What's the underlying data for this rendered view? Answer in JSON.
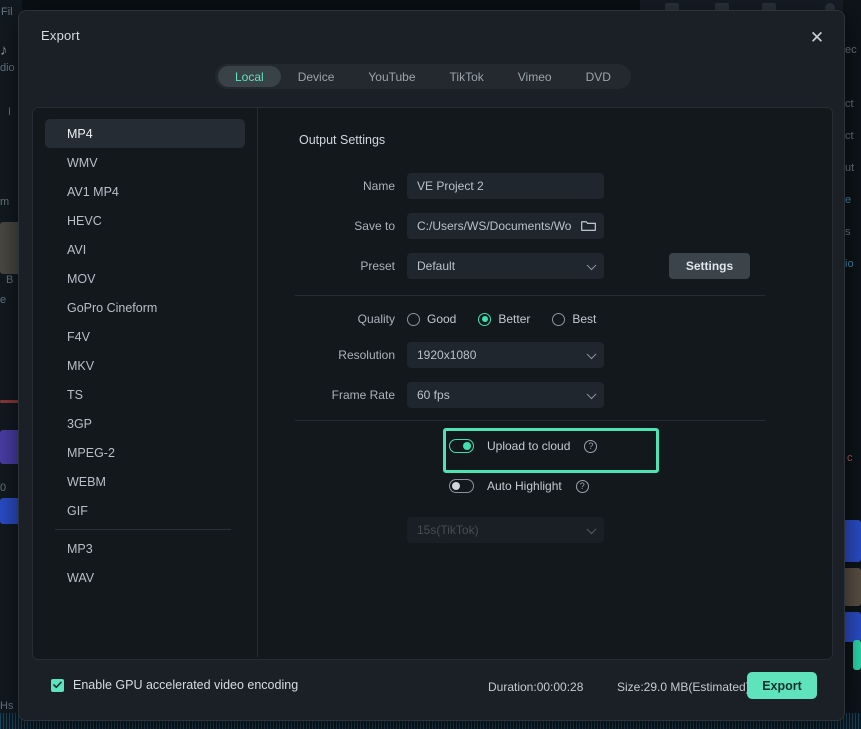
{
  "window": {
    "title": "Export",
    "close_label": "✕"
  },
  "tabs": [
    {
      "label": "Local",
      "active": true
    },
    {
      "label": "Device",
      "active": false
    },
    {
      "label": "YouTube",
      "active": false
    },
    {
      "label": "TikTok",
      "active": false
    },
    {
      "label": "Vimeo",
      "active": false
    },
    {
      "label": "DVD",
      "active": false
    }
  ],
  "formats": [
    {
      "label": "MP4",
      "active": true
    },
    {
      "label": "WMV",
      "active": false
    },
    {
      "label": "AV1 MP4",
      "active": false
    },
    {
      "label": "HEVC",
      "active": false
    },
    {
      "label": "AVI",
      "active": false
    },
    {
      "label": "MOV",
      "active": false
    },
    {
      "label": "GoPro Cineform",
      "active": false
    },
    {
      "label": "F4V",
      "active": false
    },
    {
      "label": "MKV",
      "active": false
    },
    {
      "label": "TS",
      "active": false
    },
    {
      "label": "3GP",
      "active": false
    },
    {
      "label": "MPEG-2",
      "active": false
    },
    {
      "label": "WEBM",
      "active": false
    },
    {
      "label": "GIF",
      "active": false
    },
    {
      "label": "MP3",
      "active": false,
      "divider_before": true
    },
    {
      "label": "WAV",
      "active": false
    }
  ],
  "output": {
    "section_title": "Output Settings",
    "name_label": "Name",
    "name_value": "VE Project 2",
    "saveto_label": "Save to",
    "saveto_value": "C:/Users/WS/Documents/Wo",
    "preset_label": "Preset",
    "preset_value": "Default",
    "settings_button": "Settings"
  },
  "quality": {
    "label": "Quality",
    "options": [
      {
        "label": "Good",
        "selected": false
      },
      {
        "label": "Better",
        "selected": true
      },
      {
        "label": "Best",
        "selected": false
      }
    ]
  },
  "resolution": {
    "label": "Resolution",
    "value": "1920x1080"
  },
  "framerate": {
    "label": "Frame Rate",
    "value": "60 fps"
  },
  "cloud": {
    "upload_label": "Upload to cloud",
    "upload_on": true,
    "auto_highlight_label": "Auto Highlight",
    "auto_highlight_on": false,
    "duration_select_value": "15s(TikTok)",
    "help_glyph": "?"
  },
  "footer": {
    "gpu_label": "Enable GPU accelerated video encoding",
    "gpu_checked": true,
    "duration_text": "Duration:00:00:28",
    "size_text": "Size:29.0 MB(Estimated)",
    "export_label": "Export"
  },
  "colors": {
    "accent": "#5fe3bd",
    "highlight": "#4fe3b4",
    "modal_bg": "#1b2026",
    "panel_bg": "#13181d",
    "input_bg": "#20262d"
  },
  "background_app": {
    "menu_file": "Fil",
    "label_audio": "dio",
    "label_i": "I",
    "label_m": "m",
    "label_b": "B",
    "label_e": "e",
    "label_0": "0",
    "label_hs": "Hs",
    "right_ec": "ec",
    "right_ct1": "ct",
    "right_ct2": "ct",
    "right_ut": "ut",
    "right_e": "e",
    "right_s": "s",
    "right_io": "io",
    "right_c": "c"
  }
}
